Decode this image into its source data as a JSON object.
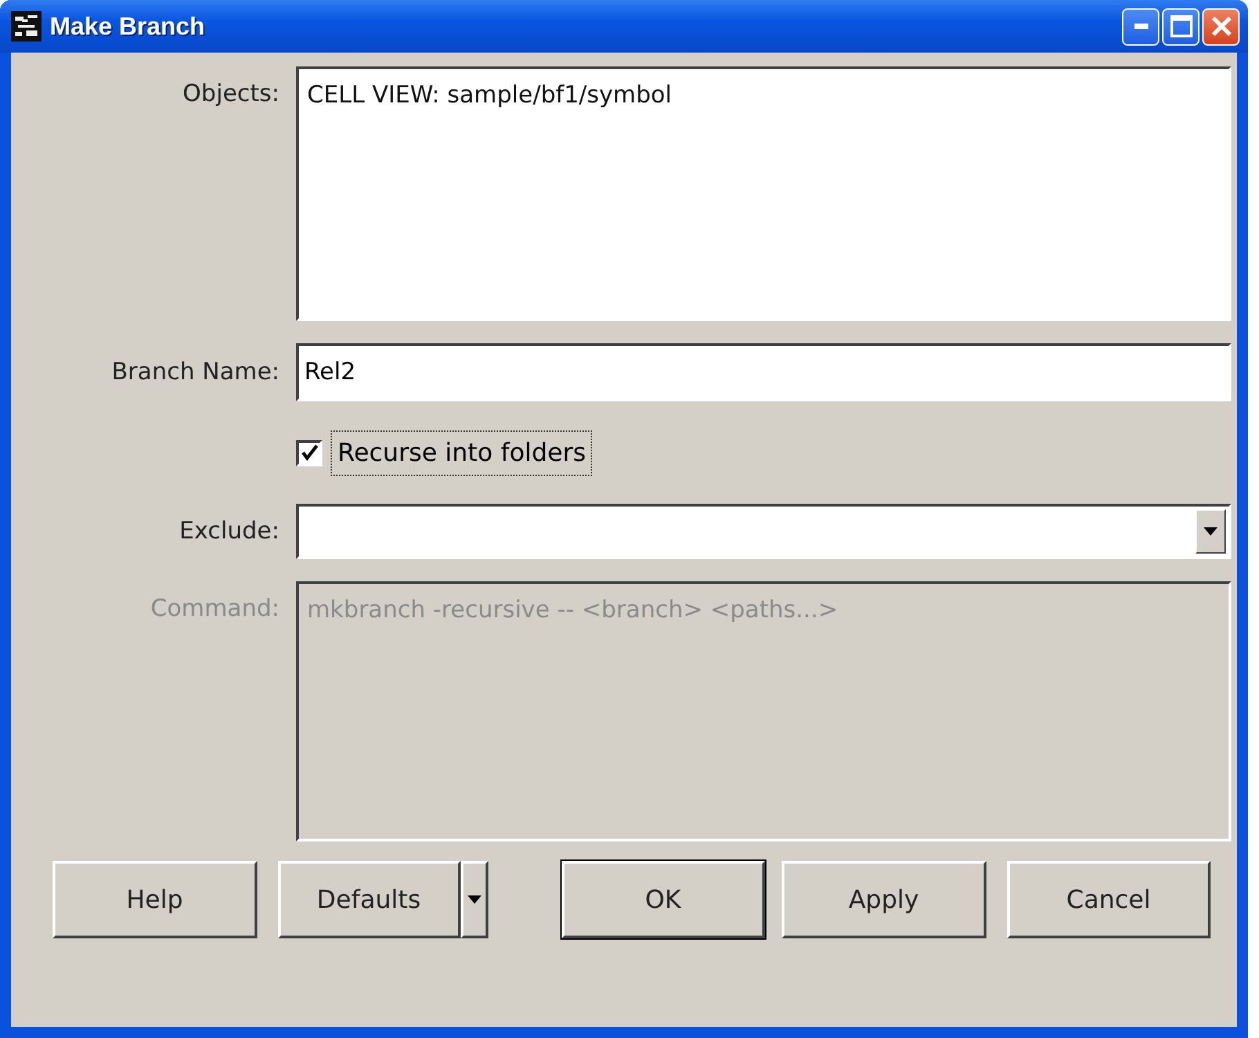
{
  "window": {
    "title": "Make Branch"
  },
  "objects": {
    "label": "Objects:",
    "value": "CELL VIEW: sample/bf1/symbol"
  },
  "branch_name": {
    "label": "Branch Name:",
    "value": "Rel2"
  },
  "recurse": {
    "label": "Recurse into folders",
    "checked": true,
    "focused": true
  },
  "exclude": {
    "label": "Exclude:"
  },
  "command": {
    "label": "Command:",
    "value": "mkbranch -recursive -- <branch> <paths...>",
    "disabled": true
  },
  "buttons": [
    {
      "label": "Help",
      "default": false,
      "menu": false
    },
    {
      "label": "Defaults",
      "default": false,
      "menu": true
    },
    {
      "label": "OK",
      "default": true,
      "menu": false
    },
    {
      "label": "Apply",
      "default": false,
      "menu": false
    },
    {
      "label": "Cancel",
      "default": false,
      "menu": false
    }
  ]
}
